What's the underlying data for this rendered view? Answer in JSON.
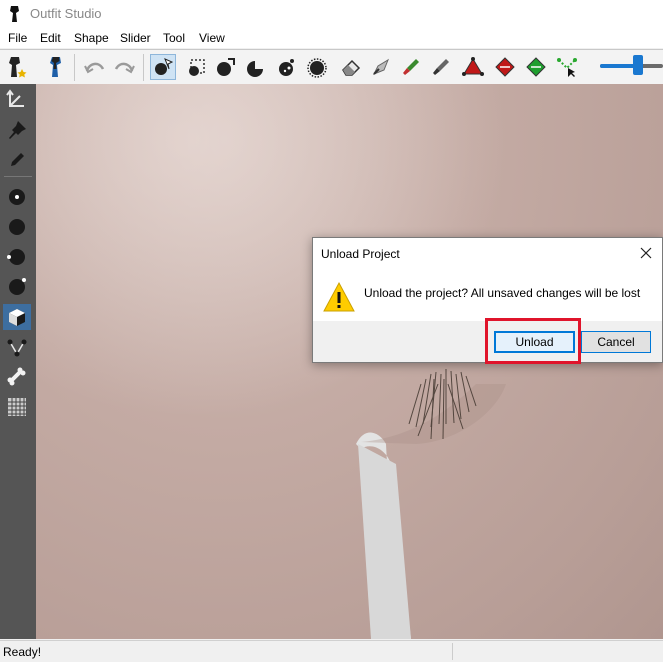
{
  "window": {
    "title": "Outfit Studio"
  },
  "menu": [
    "File",
    "Edit",
    "Shape",
    "Slider",
    "Tool",
    "View"
  ],
  "toolbar": {
    "icons": [
      "new-project-icon",
      "load-project-icon",
      "undo-icon",
      "redo-icon",
      "select-icon",
      "transform-icon",
      "brush-inflate-icon",
      "brush-deflate-icon",
      "brush-move-icon",
      "brush-smooth-icon",
      "brush-mask-icon",
      "brush-unmask-icon",
      "brush-weight-icon",
      "brush-color-icon",
      "brush-alpha-icon",
      "vertex-red-icon",
      "vertex-red-diamond-icon",
      "vertex-green-icon",
      "collapse-vertex-icon"
    ],
    "brush_size_slider": 0.6
  },
  "side_tools": [
    "anchor-icon",
    "pin-icon",
    "pencil-icon",
    "show-vertices-icon",
    "show-wireframe-icon",
    "show-lighting-icon",
    "show-textures-icon",
    "cube-icon",
    "bone-segment-icon",
    "bone-icon",
    "grid-icon"
  ],
  "status": {
    "text": "Ready!"
  },
  "dialog": {
    "title": "Unload Project",
    "message": "Unload the project? All unsaved changes will be lost",
    "unload_label": "Unload",
    "cancel_label": "Cancel"
  },
  "colors": {
    "accent": "#0078d7",
    "highlight": "#e0142b",
    "sidebar": "#555555"
  }
}
